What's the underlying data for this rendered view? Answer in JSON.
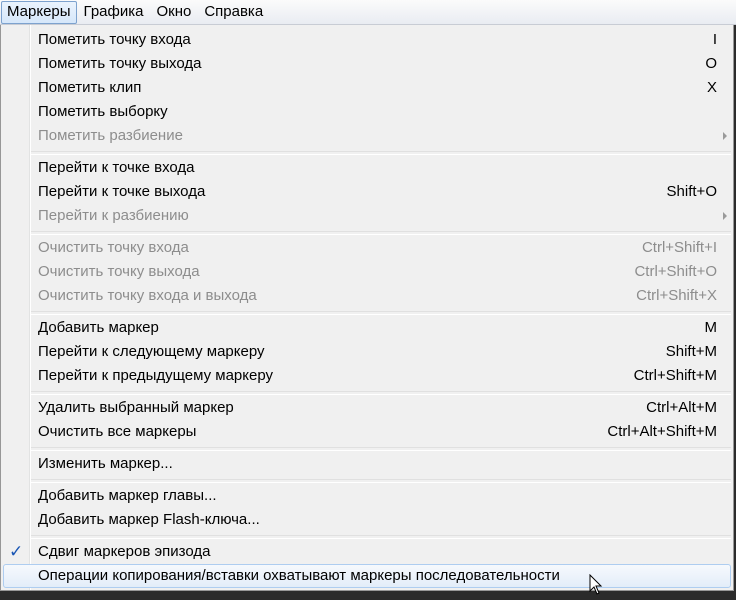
{
  "menubar": {
    "items": [
      {
        "label": "Маркеры"
      },
      {
        "label": "Графика"
      },
      {
        "label": "Окно"
      },
      {
        "label": "Справка"
      }
    ]
  },
  "menu": {
    "groups": [
      [
        {
          "label": "Пометить точку входа",
          "shortcut": "I"
        },
        {
          "label": "Пометить точку выхода",
          "shortcut": "O"
        },
        {
          "label": "Пометить клип",
          "shortcut": "X"
        },
        {
          "label": "Пометить выборку",
          "shortcut": ""
        },
        {
          "label": "Пометить разбиение",
          "shortcut": ""
        }
      ],
      [
        {
          "label": "Перейти к точке входа",
          "shortcut": ""
        },
        {
          "label": "Перейти к точке выхода",
          "shortcut": "Shift+O"
        },
        {
          "label": "Перейти к разбиению",
          "shortcut": ""
        }
      ],
      [
        {
          "label": "Очистить точку входа",
          "shortcut": "Ctrl+Shift+I"
        },
        {
          "label": "Очистить точку выхода",
          "shortcut": "Ctrl+Shift+O"
        },
        {
          "label": "Очистить точку входа и выхода",
          "shortcut": "Ctrl+Shift+X"
        }
      ],
      [
        {
          "label": "Добавить маркер",
          "shortcut": "M"
        },
        {
          "label": "Перейти к следующему маркеру",
          "shortcut": "Shift+M"
        },
        {
          "label": "Перейти к предыдущему маркеру",
          "shortcut": "Ctrl+Shift+M"
        }
      ],
      [
        {
          "label": "Удалить выбранный маркер",
          "shortcut": "Ctrl+Alt+M"
        },
        {
          "label": "Очистить все маркеры",
          "shortcut": "Ctrl+Alt+Shift+M"
        }
      ],
      [
        {
          "label": "Изменить маркер...",
          "shortcut": ""
        }
      ],
      [
        {
          "label": "Добавить маркер главы...",
          "shortcut": ""
        },
        {
          "label": "Добавить маркер Flash-ключа...",
          "shortcut": ""
        }
      ],
      [
        {
          "label": "Сдвиг маркеров эпизода",
          "shortcut": ""
        },
        {
          "label": "Операции копирования/вставки охватывают маркеры последовательности",
          "shortcut": ""
        }
      ]
    ],
    "check_glyph": "✓"
  },
  "colors": {
    "menu_bg": "#f0f0f0",
    "disabled_text": "#8d8d8d",
    "check_color": "#1a56b4",
    "hover_border": "#aecdf0"
  }
}
